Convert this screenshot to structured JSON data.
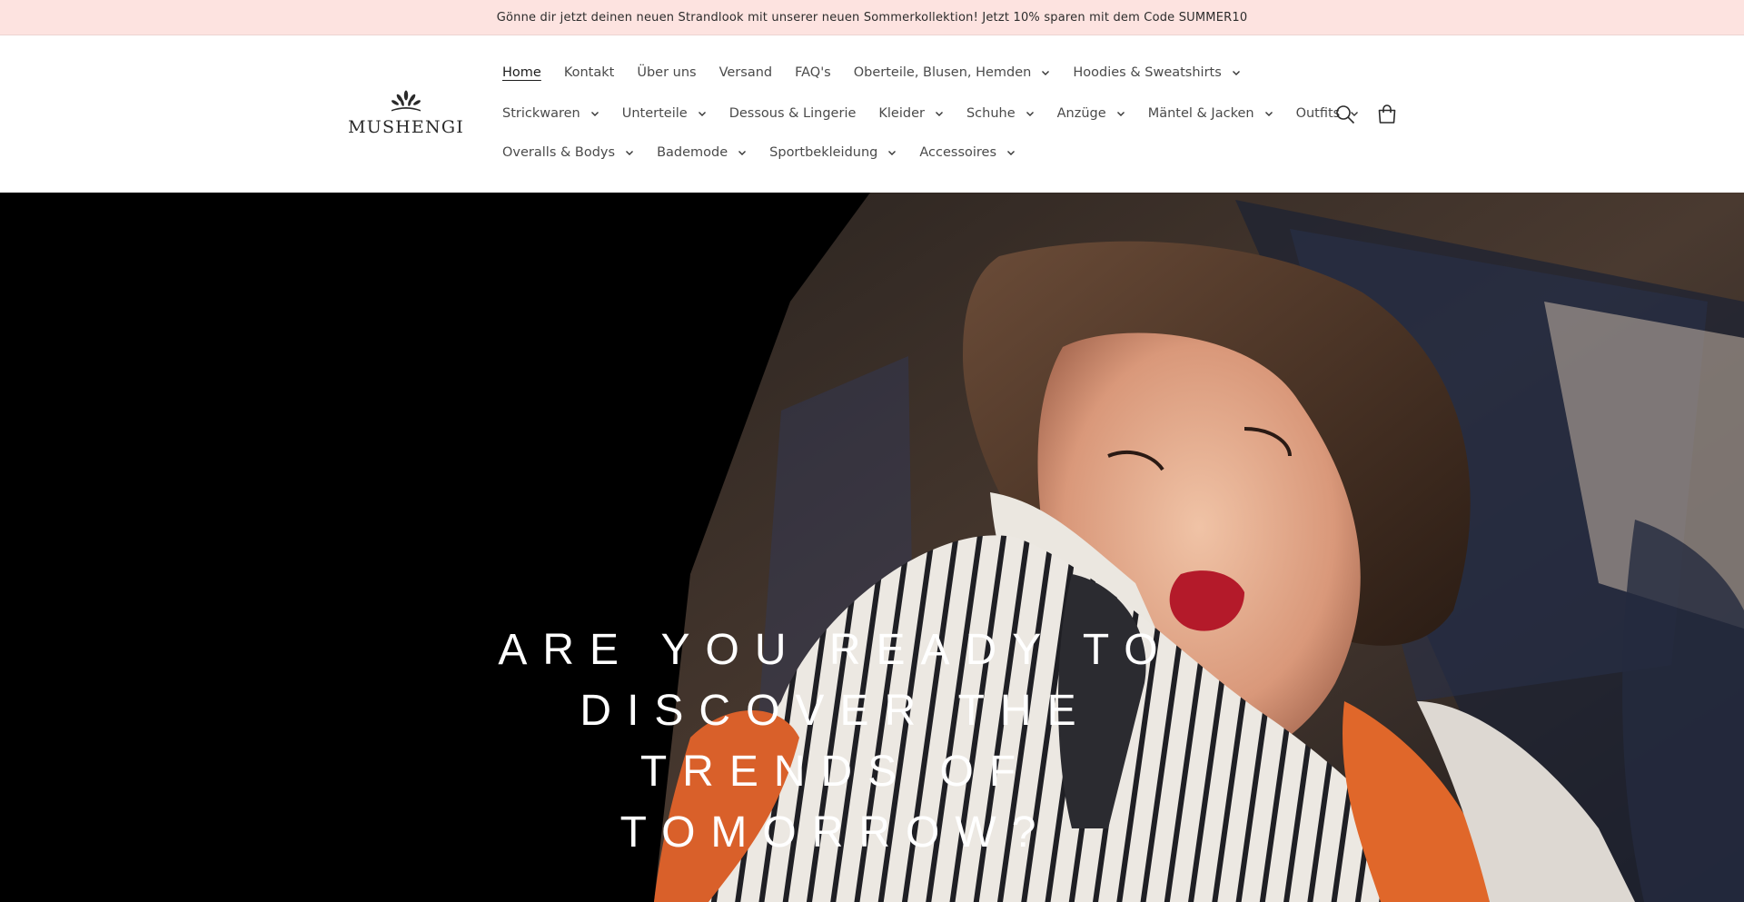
{
  "announcement": {
    "text": "Gönne dir jetzt deinen neuen Strandlook mit unserer neuen Sommerkollektion! Jetzt 10% sparen mit dem Code SUMMER10"
  },
  "logo": {
    "text": "MUSHENGI"
  },
  "nav": {
    "row1": [
      {
        "label": "Home",
        "dropdown": false,
        "active": true
      },
      {
        "label": "Kontakt",
        "dropdown": false
      },
      {
        "label": "Über uns",
        "dropdown": false
      },
      {
        "label": "Versand",
        "dropdown": false
      },
      {
        "label": "FAQ's",
        "dropdown": false
      },
      {
        "label": "Oberteile, Blusen, Hemden",
        "dropdown": true
      },
      {
        "label": "Hoodies & Sweatshirts",
        "dropdown": true
      }
    ],
    "row2": [
      {
        "label": "Strickwaren",
        "dropdown": true
      },
      {
        "label": "Unterteile",
        "dropdown": true
      },
      {
        "label": "Dessous & Lingerie",
        "dropdown": false
      },
      {
        "label": "Kleider",
        "dropdown": true
      },
      {
        "label": "Schuhe",
        "dropdown": true
      },
      {
        "label": "Anzüge",
        "dropdown": true
      },
      {
        "label": "Mäntel & Jacken",
        "dropdown": true
      },
      {
        "label": "Outfits",
        "dropdown": true
      }
    ],
    "row3": [
      {
        "label": "Overalls & Bodys",
        "dropdown": true
      },
      {
        "label": "Bademode",
        "dropdown": true
      },
      {
        "label": "Sportbekleidung",
        "dropdown": true
      },
      {
        "label": "Accessoires",
        "dropdown": true
      }
    ]
  },
  "icons": {
    "search": "search-icon",
    "cart": "cart-icon"
  },
  "hero": {
    "heading": "ARE YOU READY TO DISCOVER THE TRENDS OF TOMORROW?"
  },
  "colors": {
    "announcement_bg": "#fde3e0",
    "header_bg": "#ffffff",
    "hero_bg": "#000000",
    "hero_text": "#ffffff"
  }
}
